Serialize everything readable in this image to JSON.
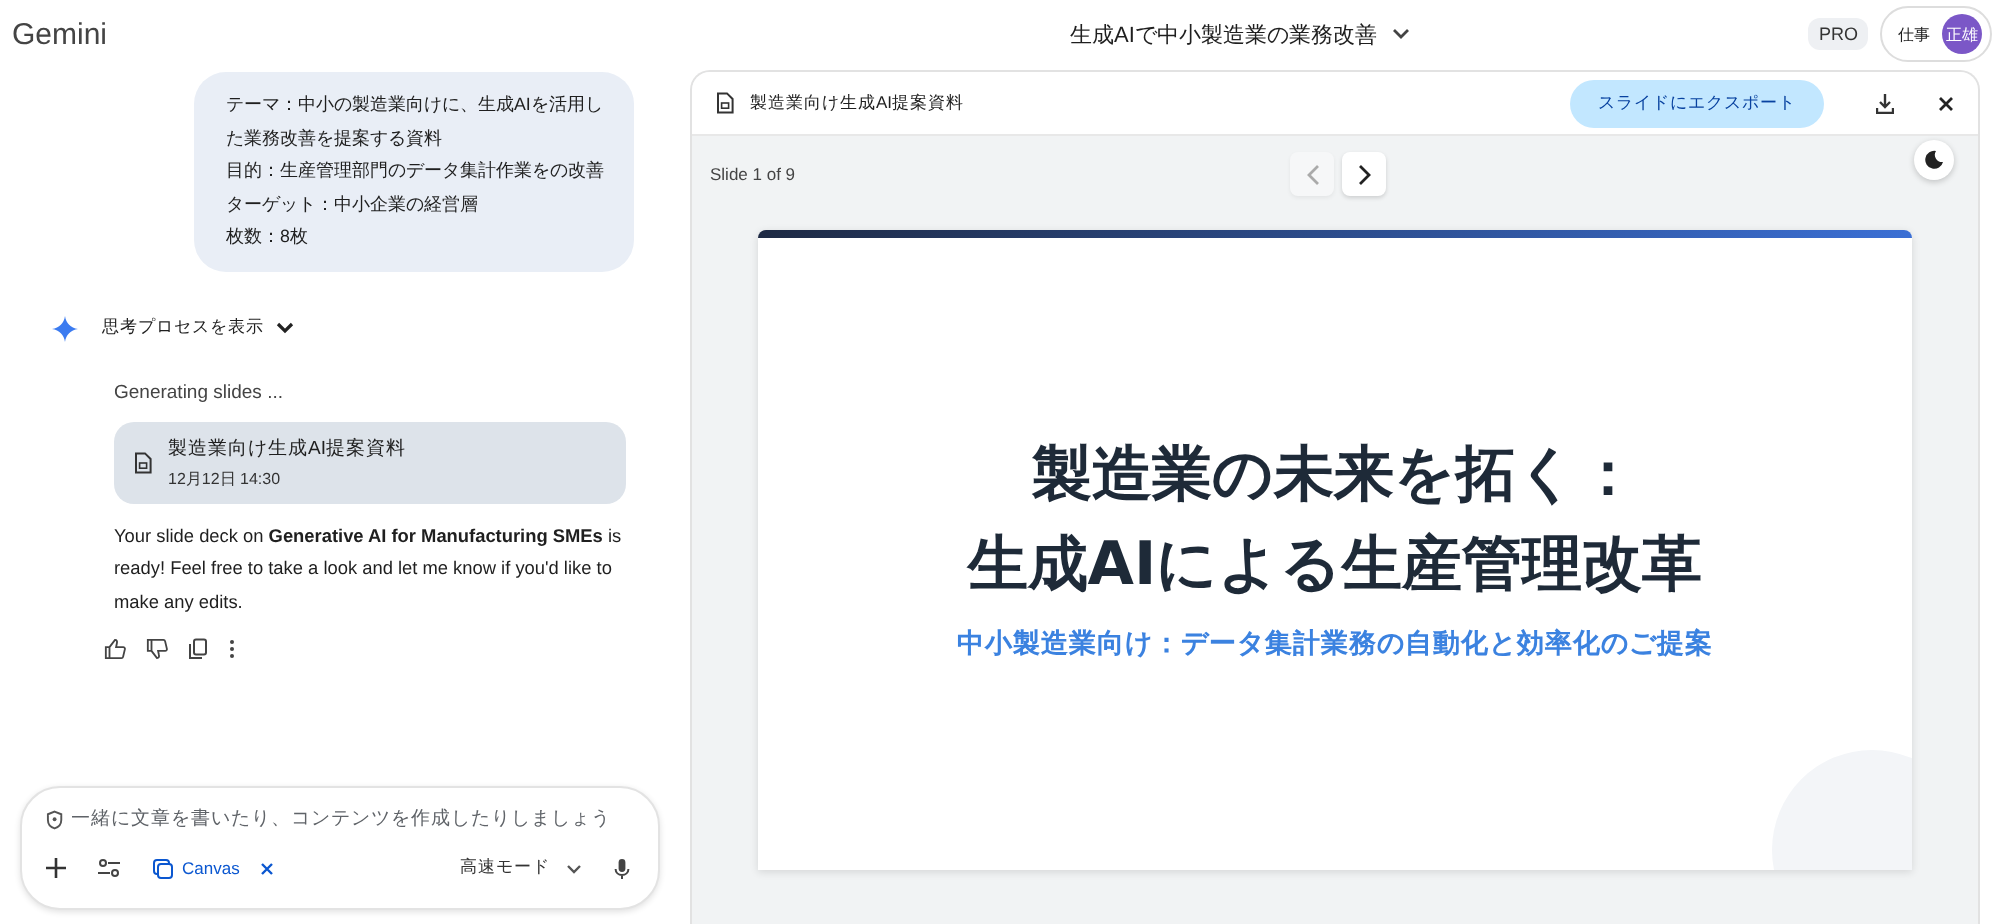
{
  "app": {
    "name": "Gemini"
  },
  "header": {
    "title": "生成AIで中小製造業の業務改善",
    "plan_badge": "PRO",
    "account_label": "仕事",
    "avatar_initials": "正雄"
  },
  "chat": {
    "user_message": [
      "テーマ：中小の製造業向けに、生成AIを活用した業務改善を提案する資料",
      "目的：生産管理部門のデータ集計作業をの改善",
      "ターゲット：中小企業の経営層",
      "枚数：8枚"
    ],
    "thinking_toggle": {
      "label": "思考プロセスを表示",
      "expanded": false
    },
    "status": "Generating slides ...",
    "file_card": {
      "title": "製造業向け生成AI提案資料",
      "date": "12月12日 14:30"
    },
    "response": "Your slide deck on **Generative AI for Manufacturing SMEs** is ready! Feel free to take a look and let me know if you'd like to make any edits."
  },
  "composer": {
    "placeholder": "一緒に文章を書いたり、コンテンツを作成したりしましょう",
    "tool_chip": "Canvas",
    "mode": "高速モード"
  },
  "canvas": {
    "title": "製造業向け生成AI提案資料",
    "export_button": "スライドにエクスポート",
    "slide_counter": "Slide 1 of 9",
    "prev_button": {
      "disabled": true
    },
    "next_button": {
      "disabled": false
    },
    "slide": {
      "title_lines": [
        "製造業の未来を拓く：",
        "生成AIによる生産管理改革"
      ],
      "subtitle": "中小製造業向け：データ集計業務の自動化と効率化のご提案"
    }
  }
}
